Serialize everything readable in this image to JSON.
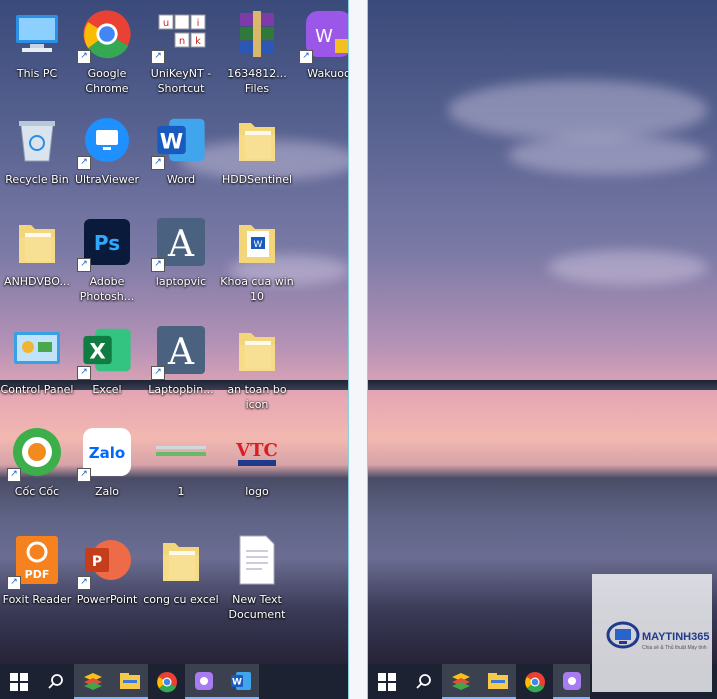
{
  "desktop_icons": [
    {
      "label": "This PC",
      "icon": "this-pc-icon",
      "shortcut": false
    },
    {
      "label": "Google Chrome",
      "icon": "chrome-icon",
      "shortcut": true
    },
    {
      "label": "UniKeyNT - Shortcut",
      "icon": "unikey-icon",
      "shortcut": true
    },
    {
      "label": "1634812... Files",
      "icon": "winrar-icon",
      "shortcut": false
    },
    {
      "label": "Wakuoo",
      "icon": "wakuoo-icon",
      "shortcut": true
    },
    {
      "label": "Recycle Bin",
      "icon": "recycle-bin-icon",
      "shortcut": false
    },
    {
      "label": "UltraViewer",
      "icon": "ultraviewer-icon",
      "shortcut": true
    },
    {
      "label": "Word",
      "icon": "word-icon",
      "shortcut": true
    },
    {
      "label": "HDDSentinel",
      "icon": "folder-icon",
      "shortcut": false
    },
    {
      "label": "ANHDVBO...",
      "icon": "folder-icon",
      "shortcut": false
    },
    {
      "label": "Adobe Photosh...",
      "icon": "photoshop-icon",
      "shortcut": true
    },
    {
      "label": "laptopvic",
      "icon": "font-a-icon",
      "shortcut": true
    },
    {
      "label": "Khoa cua win 10",
      "icon": "word-folder-icon",
      "shortcut": false
    },
    {
      "label": "Control Panel",
      "icon": "control-panel-icon",
      "shortcut": false
    },
    {
      "label": "Excel",
      "icon": "excel-icon",
      "shortcut": true
    },
    {
      "label": "Laptopbin...",
      "icon": "font-a-icon",
      "shortcut": true
    },
    {
      "label": "an toan bo icon",
      "icon": "folder-icon",
      "shortcut": false
    },
    {
      "label": "Cốc Cốc",
      "icon": "coccoc-icon",
      "shortcut": true
    },
    {
      "label": "Zalo",
      "icon": "zalo-icon",
      "shortcut": true
    },
    {
      "label": "1",
      "icon": "image-file-icon",
      "shortcut": false
    },
    {
      "label": "logo",
      "icon": "vtc-logo-icon",
      "shortcut": false
    },
    {
      "label": "Foxit Reader",
      "icon": "foxit-pdf-icon",
      "shortcut": true
    },
    {
      "label": "PowerPoint",
      "icon": "powerpoint-icon",
      "shortcut": true
    },
    {
      "label": "cong cu excel",
      "icon": "folder-icon",
      "shortcut": false
    },
    {
      "label": "New Text Document",
      "icon": "text-document-icon",
      "shortcut": false
    }
  ],
  "taskbar_left": [
    "windows-start-icon",
    "search-icon",
    "bluestacks-icon",
    "file-explorer-icon",
    "chrome-icon",
    "app-icon",
    "word-icon"
  ],
  "taskbar_right": [
    "windows-start-icon",
    "search-icon",
    "bluestacks-icon",
    "file-explorer-icon",
    "chrome-icon",
    "app-icon"
  ],
  "watermark": {
    "brand": "MAYTINH365",
    "tagline": "Chia sẻ & Thủ thuật Máy tính"
  },
  "colors": {
    "split_divider": "#f4f6f9",
    "divider_border": "#8ad0e0",
    "taskbar": "#1e2434"
  }
}
